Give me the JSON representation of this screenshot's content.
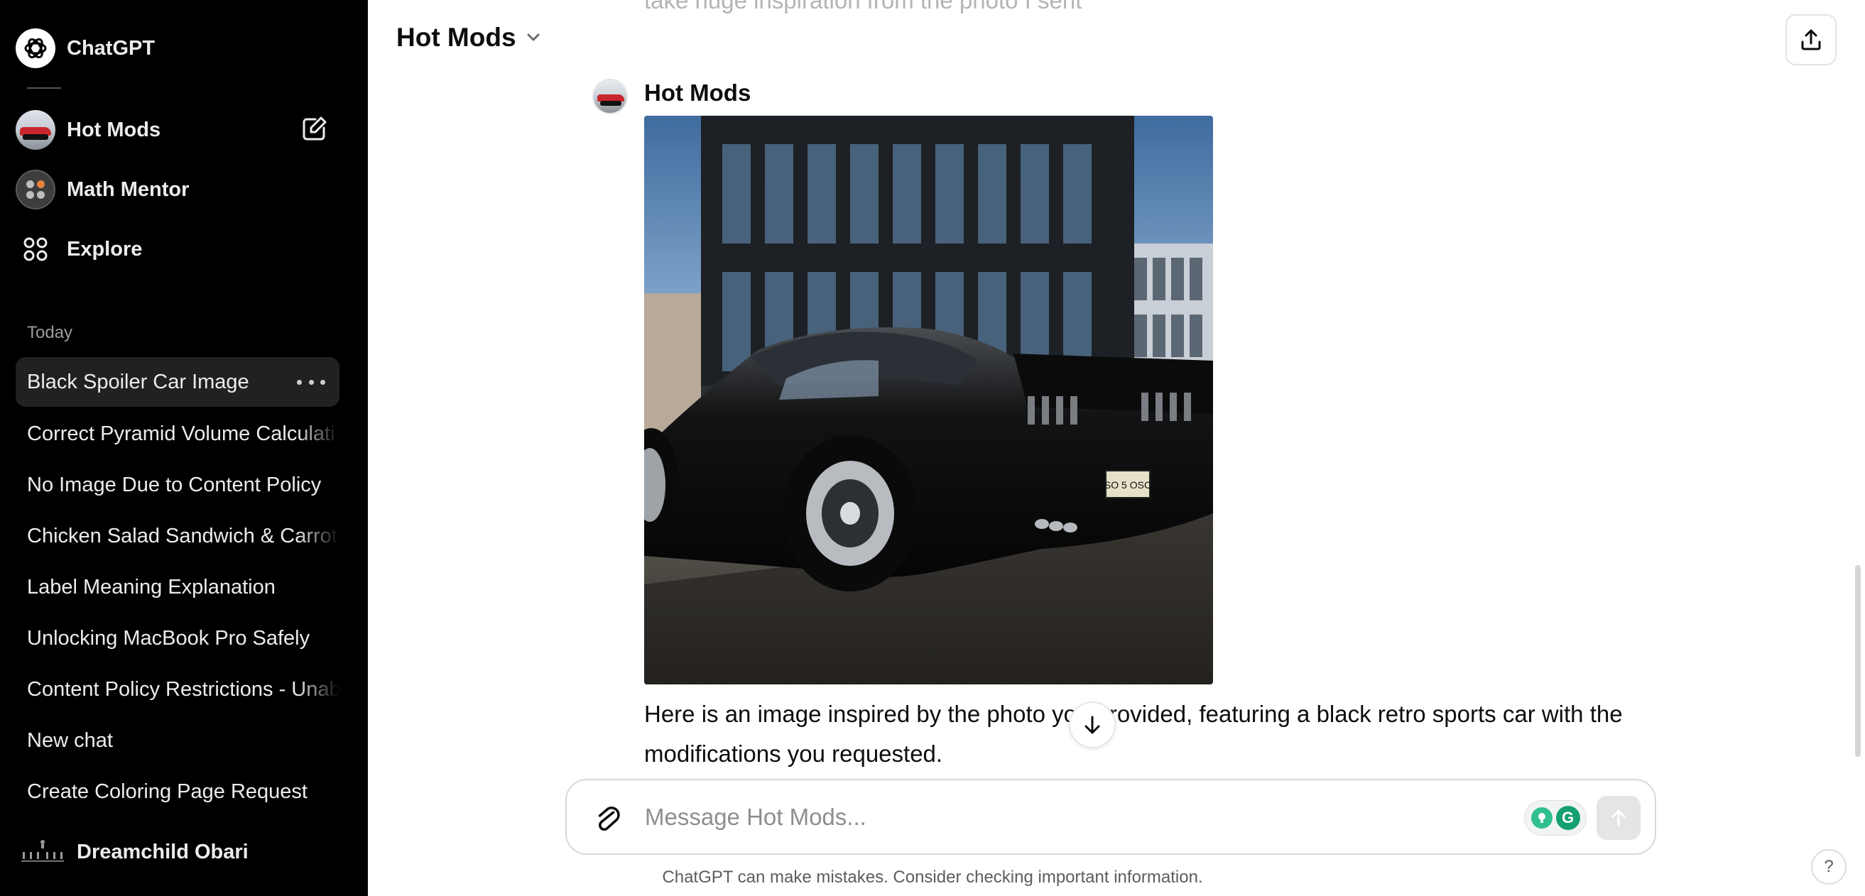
{
  "sidebar": {
    "app_name": "ChatGPT",
    "gpts": [
      {
        "label": "Hot Mods",
        "icon": "car-avatar-icon"
      },
      {
        "label": "Math Mentor",
        "icon": "math-mentor-avatar-icon"
      },
      {
        "label": "Explore",
        "icon": "explore-grid-icon"
      }
    ],
    "section_today": "Today",
    "chats": [
      "Black Spoiler Car Image",
      "Correct Pyramid Volume Calculati",
      "No Image Due to Content Policy",
      "Chicken Salad Sandwich & Carrot",
      "Label Meaning Explanation",
      "Unlocking MacBook Pro Safely",
      "Content Policy Restrictions - Unab",
      "New chat",
      "Create Coloring Page Request"
    ],
    "user_name": "Dreamchild Obari"
  },
  "header": {
    "title": "Hot Mods"
  },
  "conversation": {
    "previous_text_cut": "take huge inspiration from the photo I sent",
    "author": "Hot Mods",
    "image_alt": "black retro sports car with spoiler in front of modern building",
    "plate_text": "SO 5 OSC",
    "response": "Here is an image inspired by the photo you provided, featuring a black retro sports car with the modifications you requested."
  },
  "composer": {
    "placeholder": "Message Hot Mods...",
    "ext_letter": "G"
  },
  "footer": {
    "note": "ChatGPT can make mistakes. Consider checking important information.",
    "help": "?"
  },
  "colors": {
    "sidebar_bg": "#000000",
    "active_item_bg": "#212121",
    "grammarly_green": "#15a06f"
  }
}
